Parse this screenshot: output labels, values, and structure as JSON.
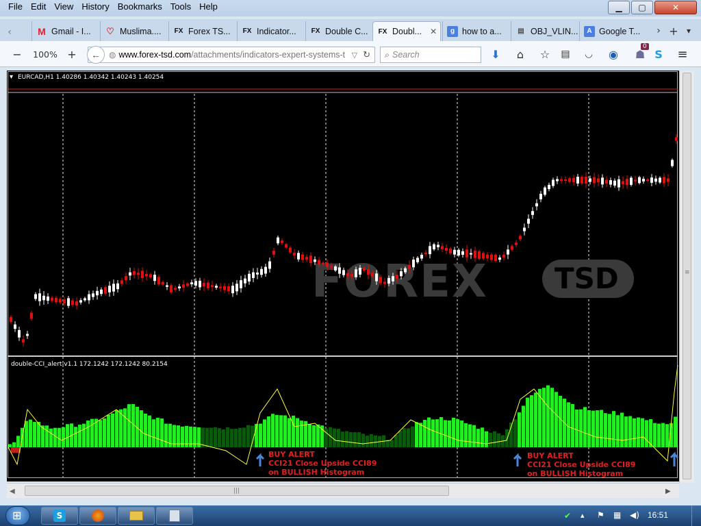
{
  "menubar": {
    "items": [
      {
        "label": "File"
      },
      {
        "label": "Edit"
      },
      {
        "label": "View"
      },
      {
        "label": "History"
      },
      {
        "label": "Bookmarks"
      },
      {
        "label": "Tools"
      },
      {
        "label": "Help"
      }
    ]
  },
  "tabs": [
    {
      "label": "Gmail - I...",
      "icon": "gmail-icon"
    },
    {
      "label": "Muslima....",
      "icon": "heart-icon"
    },
    {
      "label": "Forex TS...",
      "icon": "fx-icon"
    },
    {
      "label": "Indicator...",
      "icon": "fx-icon"
    },
    {
      "label": "Double C...",
      "icon": "fx-icon"
    },
    {
      "label": "Doubl...",
      "icon": "fx-icon",
      "active": true
    },
    {
      "label": "how to a...",
      "icon": "google-icon"
    },
    {
      "label": "OBJ_VLIN...",
      "icon": "document-icon"
    },
    {
      "label": "Google T...",
      "icon": "translate-icon"
    }
  ],
  "nav": {
    "zoom": "100%",
    "url": "www.forex-tsd.com/attachments/indicators-expert-systems-t",
    "url_domain": "www.forex-tsd.com",
    "url_path": "/attachments/indicators-expert-systems-t",
    "search_placeholder": "Search",
    "badge_count": "0"
  },
  "chart": {
    "price_header": "EURCAD,H1  1.40286 1.40342 1.40243 1.40254",
    "indicator_header": "double-CCI_alert-v1.1 172.1242 172.1242 80.2154",
    "watermark_left": "FOREX",
    "watermark_right": "TSD",
    "alerts": [
      {
        "title": "BUY ALERT",
        "line1": "CCI21 Close Upside CCI89",
        "line2": "on BULLISH Histogram"
      },
      {
        "title": "BUY ALERT",
        "line1": "CCI21 Close Upside CCI89",
        "line2": "on BULLISH Histogram"
      }
    ],
    "colors": {
      "bull": "#ffffff",
      "bear": "#e01010",
      "hist_bright": "#22ee22",
      "hist_dark": "#0b5a0b",
      "cci": "#ffff33",
      "alert": "#e02020",
      "arrow": "#4a86d8"
    }
  },
  "taskbar": {
    "clock": "16:51",
    "items": [
      {
        "icon": "skype-icon"
      },
      {
        "icon": "firefox-icon"
      },
      {
        "icon": "folder-icon"
      },
      {
        "icon": "calculator-icon"
      }
    ]
  }
}
